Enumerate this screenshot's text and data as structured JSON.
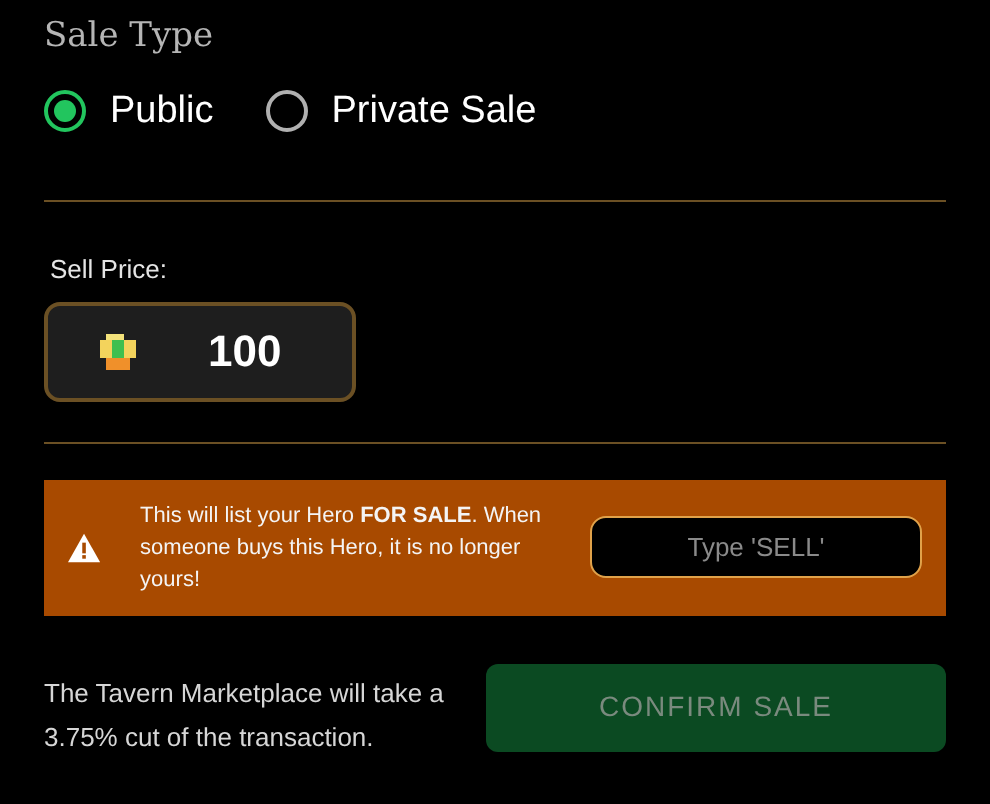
{
  "sale_type": {
    "title": "Sale Type",
    "options": [
      {
        "label": "Public",
        "selected": true
      },
      {
        "label": "Private Sale",
        "selected": false
      }
    ]
  },
  "sell_price": {
    "label": "Sell Price:",
    "value": "100"
  },
  "warning": {
    "message": "This will list your Hero **FOR SALE**. When someone buys this Hero, it is no longer yours!",
    "confirm_field": {
      "placeholder": "Type 'SELL'"
    }
  },
  "footer": {
    "note": "The Tavern Marketplace will take a 3.75% cut of the transaction.",
    "confirm_button": {
      "label": "CONFIRM SALE",
      "disabled": true
    }
  }
}
